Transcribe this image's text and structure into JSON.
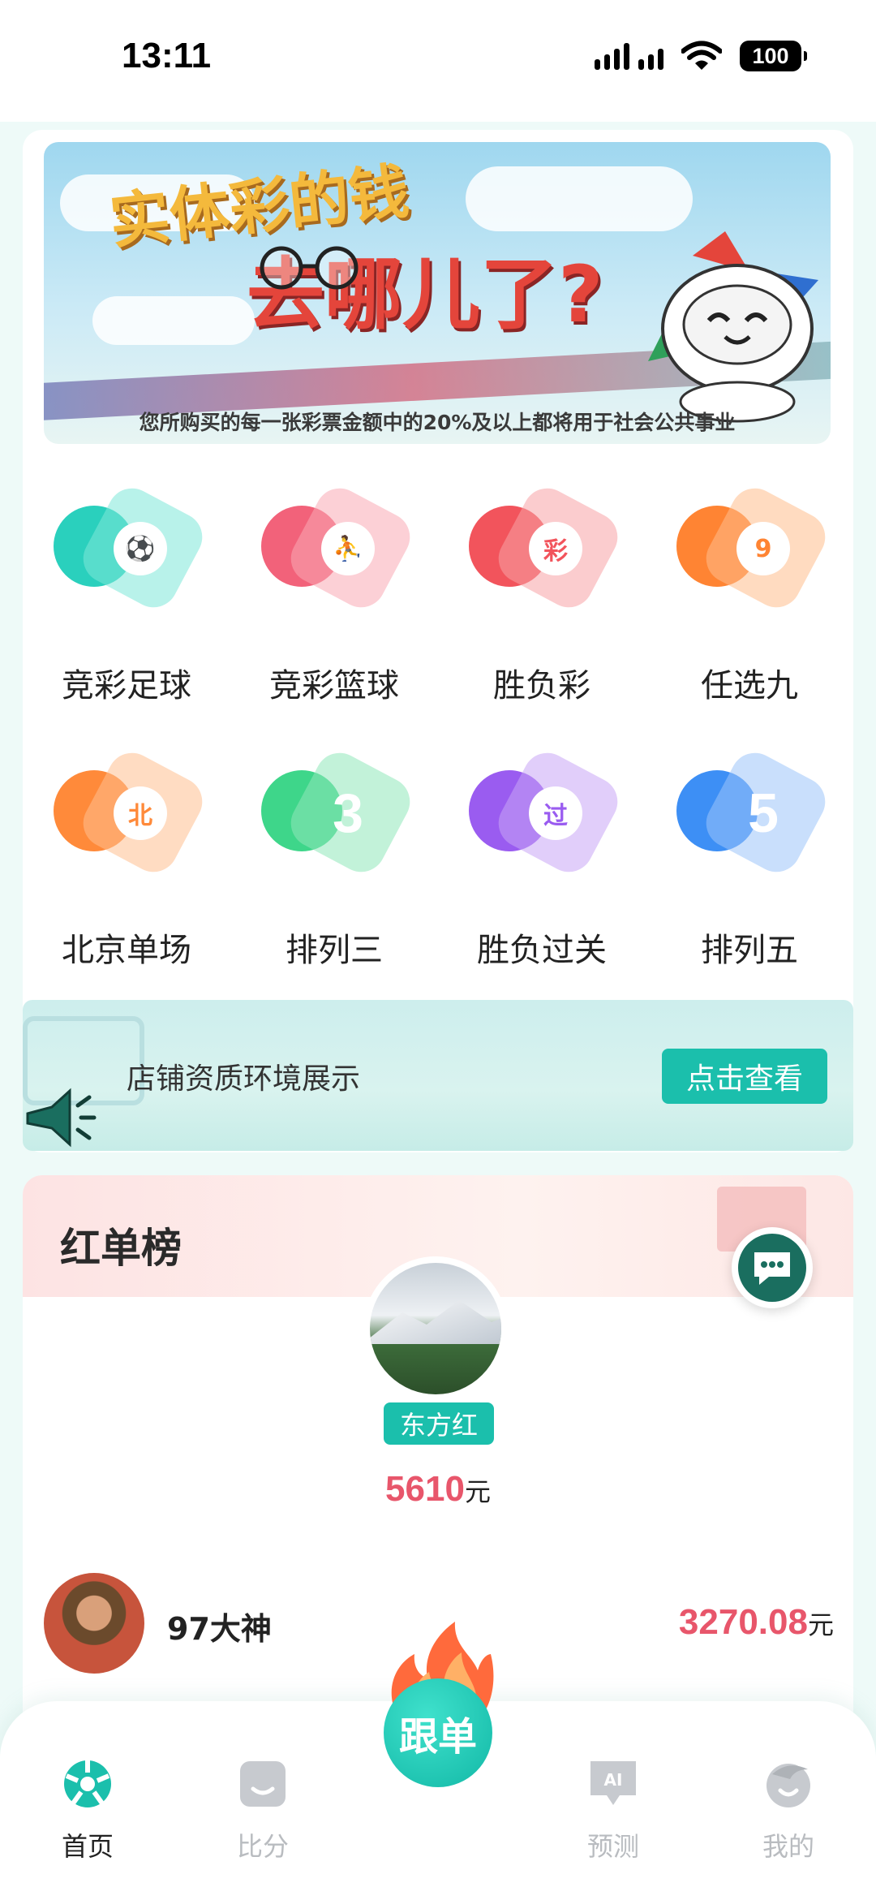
{
  "status_bar": {
    "time": "13:11",
    "battery": "100"
  },
  "banner": {
    "headline_1": "实体彩的钱",
    "headline_2": "去哪儿了?",
    "footer": "您所购买的每一张彩票金额中的20%及以上都将用于社会公共事业"
  },
  "games": [
    {
      "label": "竞彩足球",
      "icon": "soccer-ball-icon",
      "glyph": "⚽",
      "color": "#2ad0bd",
      "glyph_color": "#23c2b0"
    },
    {
      "label": "竞彩篮球",
      "icon": "basketball-icon",
      "glyph": "⛹",
      "color": "#f2627a",
      "glyph_color": "#f2627a"
    },
    {
      "label": "胜负彩",
      "icon": "lottery-cai-icon",
      "glyph": "彩",
      "color": "#f2545c",
      "glyph_color": "#f2545c"
    },
    {
      "label": "任选九",
      "icon": "number-nine-icon",
      "glyph": "9",
      "color": "#ff8433",
      "glyph_color": "#ff8433"
    },
    {
      "label": "北京单场",
      "icon": "beijing-ball-icon",
      "glyph": "北",
      "color": "#ff8a3a",
      "glyph_color": "#ff8a3a"
    },
    {
      "label": "排列三",
      "icon": "number-three-icon",
      "glyph": "3",
      "color": "#3ed68a",
      "glyph_color": "#ffffff"
    },
    {
      "label": "胜负过关",
      "icon": "pass-ball-icon",
      "glyph": "过",
      "color": "#9a5cf0",
      "glyph_color": "#9a5cf0"
    },
    {
      "label": "排列五",
      "icon": "number-five-icon",
      "glyph": "5",
      "color": "#3d8ff5",
      "glyph_color": "#ffffff"
    }
  ],
  "notice": {
    "text": "店铺资质环境展示",
    "button_label": "点击查看",
    "icon": "megaphone-icon"
  },
  "ranking": {
    "title": "红单榜",
    "top": {
      "name": "东方红",
      "amount": "5610",
      "unit": "元"
    },
    "rows": [
      {
        "name": "97大神",
        "amount": "3270.08",
        "unit": "元"
      }
    ]
  },
  "nav": {
    "items": [
      {
        "label": "首页",
        "icon": "home-ball-icon",
        "active": true
      },
      {
        "label": "比分",
        "icon": "scoreboard-icon",
        "active": false
      },
      {
        "label": "预测",
        "icon": "ai-chat-icon",
        "active": false
      },
      {
        "label": "我的",
        "icon": "profile-icon",
        "active": false
      }
    ],
    "center_button": {
      "label": "跟单",
      "icon": "flame-icon"
    }
  },
  "colors": {
    "accent": "#1bbfac",
    "amount": "#e8566b"
  }
}
